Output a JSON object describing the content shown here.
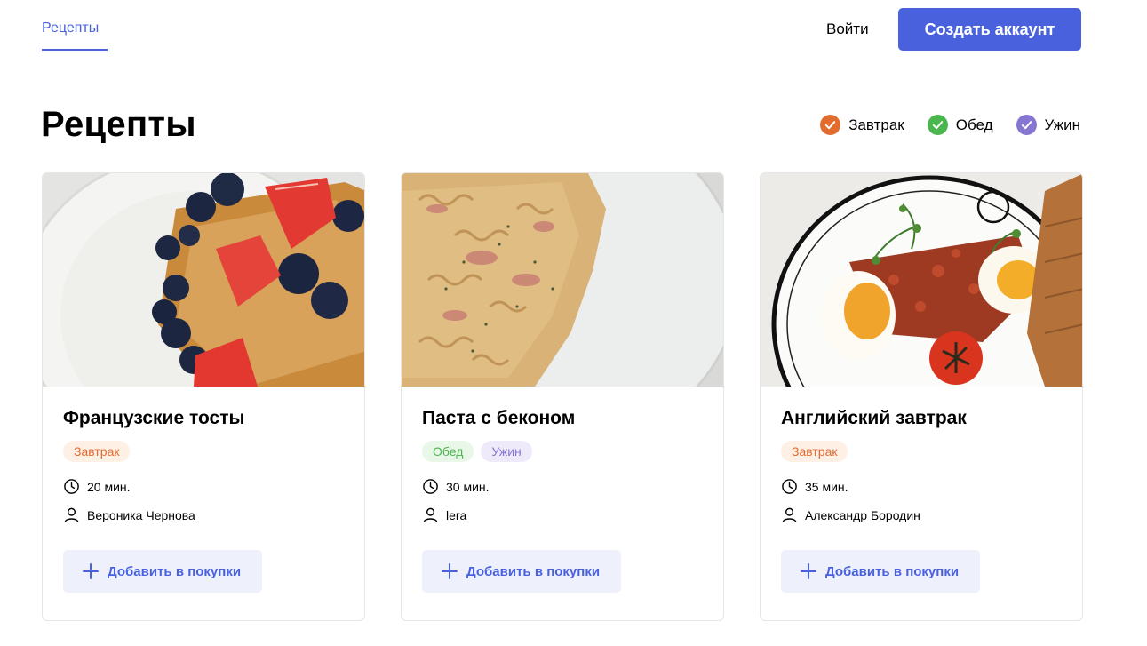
{
  "header": {
    "nav_recipes": "Рецепты",
    "login": "Войти",
    "signup": "Создать аккаунт",
    "accent_color": "#4a61dd"
  },
  "page_title": "Рецепты",
  "filters": [
    {
      "label": "Завтрак",
      "color": "#e26c2d",
      "checked": true
    },
    {
      "label": "Обед",
      "color": "#49b64e",
      "checked": true
    },
    {
      "label": "Ужин",
      "color": "#8775d2",
      "checked": true
    }
  ],
  "cards": [
    {
      "title": "Французские тосты",
      "tags": [
        "Завтрак"
      ],
      "time": "20 мин.",
      "author": "Вероника Чернова",
      "button": "Добавить в покупки"
    },
    {
      "title": "Паста с беконом",
      "tags": [
        "Обед",
        "Ужин"
      ],
      "time": "30 мин.",
      "author": "lera",
      "button": "Добавить в покупки"
    },
    {
      "title": "Английский завтрак",
      "tags": [
        "Завтрак"
      ],
      "time": "35 мин.",
      "author": "Александр Бородин",
      "button": "Добавить в покупки"
    }
  ]
}
